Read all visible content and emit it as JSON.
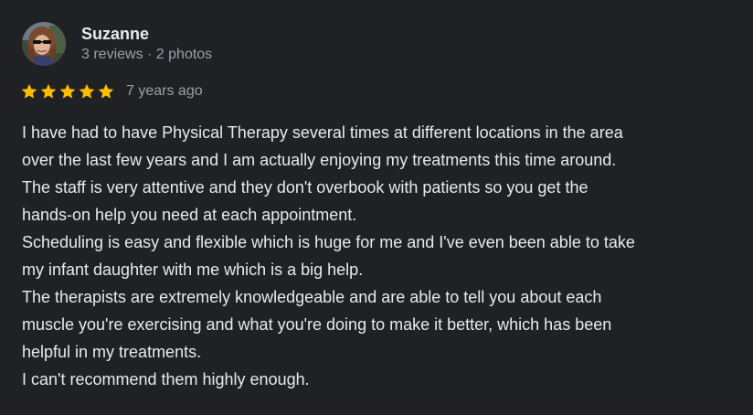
{
  "reviewer": {
    "name": "Suzanne",
    "meta": "3 reviews · 2 photos",
    "avatar_icon": "profile-photo"
  },
  "rating": {
    "stars": 5,
    "max_stars": 5,
    "star_color": "#fbbc04",
    "time_ago": "7 years ago"
  },
  "review": {
    "lines": [
      "I have had to have Physical Therapy several times at different locations in the area",
      "over the last few years and I am actually enjoying my treatments this time around.",
      "The staff is very attentive and they don't overbook with patients so you get the",
      "hands-on help you need at each appointment.",
      "Scheduling is easy and flexible which is huge for me and I've even been able to take",
      "my infant daughter with me which is a big help.",
      "The therapists are extremely knowledgeable and are able to tell you about each",
      "muscle you're exercising and what you're doing to make it better, which has been",
      "helpful in my treatments.",
      "I can't recommend them highly enough."
    ]
  },
  "colors": {
    "background": "#202124",
    "text_primary": "#e8eaed",
    "text_secondary": "#9aa0a6"
  }
}
